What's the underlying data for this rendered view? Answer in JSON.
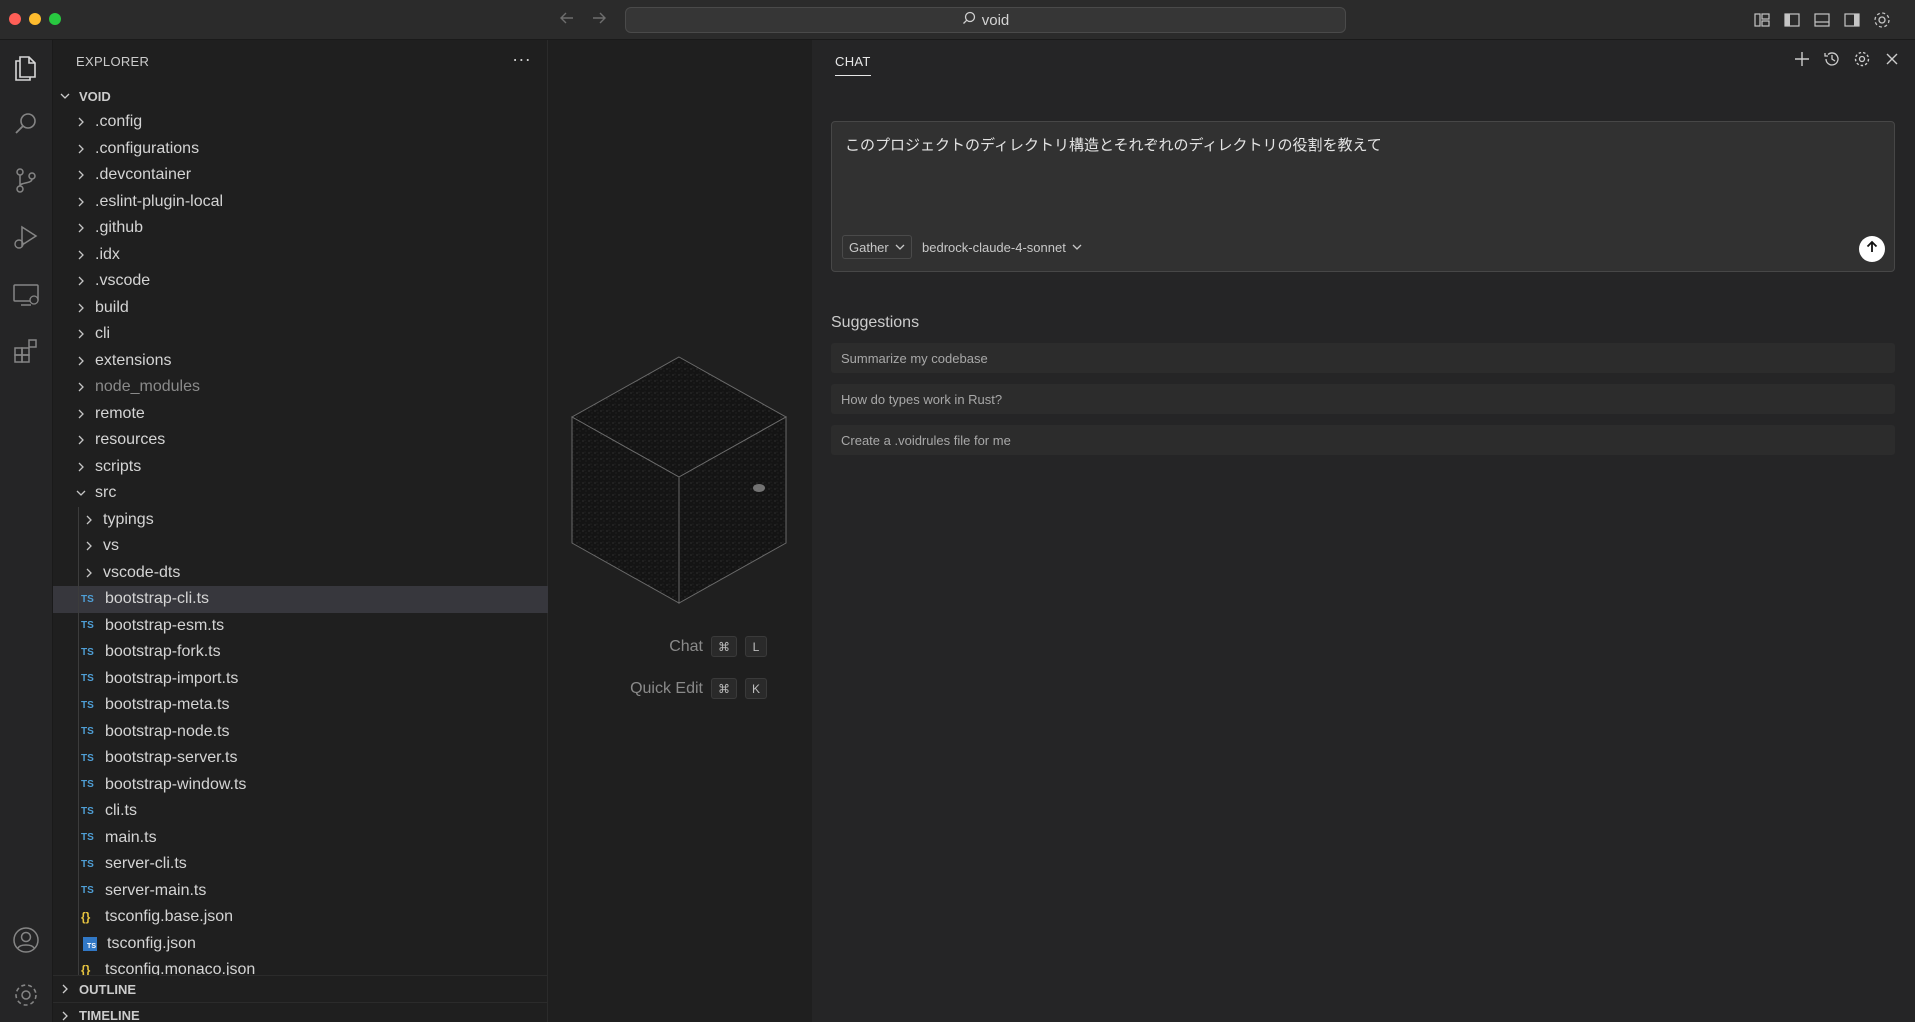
{
  "titlebar": {
    "search_text": "void"
  },
  "explorer": {
    "header": "EXPLORER",
    "more": "···",
    "root_label": "VOID",
    "items": [
      {
        "label": ".config",
        "kind": "folder",
        "depth": 0
      },
      {
        "label": ".configurations",
        "kind": "folder",
        "depth": 0
      },
      {
        "label": ".devcontainer",
        "kind": "folder",
        "depth": 0
      },
      {
        "label": ".eslint-plugin-local",
        "kind": "folder",
        "depth": 0
      },
      {
        "label": ".github",
        "kind": "folder",
        "depth": 0
      },
      {
        "label": ".idx",
        "kind": "folder",
        "depth": 0
      },
      {
        "label": ".vscode",
        "kind": "folder",
        "depth": 0
      },
      {
        "label": "build",
        "kind": "folder",
        "depth": 0
      },
      {
        "label": "cli",
        "kind": "folder",
        "depth": 0
      },
      {
        "label": "extensions",
        "kind": "folder",
        "depth": 0
      },
      {
        "label": "node_modules",
        "kind": "folder",
        "depth": 0,
        "dim": true
      },
      {
        "label": "remote",
        "kind": "folder",
        "depth": 0
      },
      {
        "label": "resources",
        "kind": "folder",
        "depth": 0
      },
      {
        "label": "scripts",
        "kind": "folder",
        "depth": 0
      },
      {
        "label": "src",
        "kind": "folder-open",
        "depth": 0
      },
      {
        "label": "typings",
        "kind": "folder",
        "depth": 1
      },
      {
        "label": "vs",
        "kind": "folder",
        "depth": 1
      },
      {
        "label": "vscode-dts",
        "kind": "folder",
        "depth": 1
      },
      {
        "label": "bootstrap-cli.ts",
        "kind": "ts",
        "depth": 1,
        "selected": true
      },
      {
        "label": "bootstrap-esm.ts",
        "kind": "ts",
        "depth": 1
      },
      {
        "label": "bootstrap-fork.ts",
        "kind": "ts",
        "depth": 1
      },
      {
        "label": "bootstrap-import.ts",
        "kind": "ts",
        "depth": 1
      },
      {
        "label": "bootstrap-meta.ts",
        "kind": "ts",
        "depth": 1
      },
      {
        "label": "bootstrap-node.ts",
        "kind": "ts",
        "depth": 1
      },
      {
        "label": "bootstrap-server.ts",
        "kind": "ts",
        "depth": 1
      },
      {
        "label": "bootstrap-window.ts",
        "kind": "ts",
        "depth": 1
      },
      {
        "label": "cli.ts",
        "kind": "ts",
        "depth": 1
      },
      {
        "label": "main.ts",
        "kind": "ts",
        "depth": 1
      },
      {
        "label": "server-cli.ts",
        "kind": "ts",
        "depth": 1
      },
      {
        "label": "server-main.ts",
        "kind": "ts",
        "depth": 1
      },
      {
        "label": "tsconfig.base.json",
        "kind": "json",
        "depth": 1
      },
      {
        "label": "tsconfig.json",
        "kind": "tsjson",
        "depth": 1
      },
      {
        "label": "tsconfig.monaco.json",
        "kind": "json",
        "depth": 1
      }
    ],
    "outline_label": "OUTLINE",
    "timeline_label": "TIMELINE",
    "ts_badge": "TS",
    "json_badge": "{}",
    "tsjson_badge": "TS"
  },
  "editor": {
    "shortcuts": [
      {
        "label": "Chat",
        "keys": [
          "⌘",
          "L"
        ]
      },
      {
        "label": "Quick Edit",
        "keys": [
          "⌘",
          "K"
        ]
      }
    ]
  },
  "chat": {
    "tab_label": "CHAT",
    "input_text": "このプロジェクトのディレクトリ構造とそれぞれのディレクトリの役割を教えて",
    "mode": "Gather",
    "model": "bedrock-claude-4-sonnet",
    "suggestions_title": "Suggestions",
    "suggestions": [
      "Summarize my codebase",
      "How do types work in Rust?",
      "Create a .voidrules file for me"
    ]
  },
  "colors": {
    "accent_ts": "#4f9fd6",
    "accent_json": "#e8c53f",
    "selection": "#37373d"
  }
}
